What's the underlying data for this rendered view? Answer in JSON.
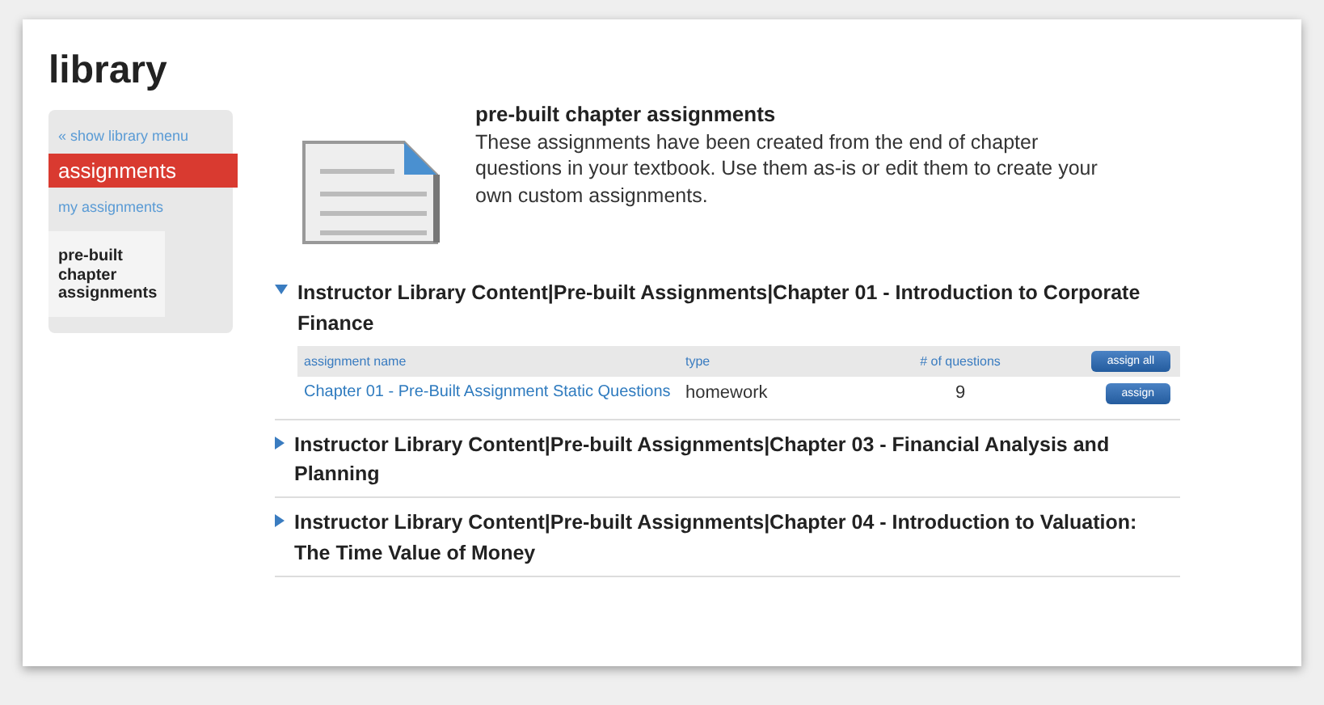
{
  "page_title": "library",
  "sidebar": {
    "items": [
      {
        "label": "« show library menu",
        "kind": "link",
        "selected": false
      },
      {
        "label": "assignments",
        "kind": "tab",
        "selected": true
      },
      {
        "label": "my assignments",
        "kind": "link",
        "selected": false
      },
      {
        "label": "pre-built chapter assignments",
        "kind": "current",
        "selected": false
      }
    ]
  },
  "intro": {
    "title": "pre-built chapter assignments",
    "text": "These assignments have been created from the end of chapter questions in your textbook. Use them as-is or edit them to create your own custom assignments."
  },
  "sections": [
    {
      "title": "Instructor Library Content|Pre-built Assignments|Chapter 01 - Introduction to Corporate Finance",
      "expanded": true,
      "table": {
        "columns": [
          "assignment name",
          "type",
          "# of questions"
        ],
        "header_button": "assign all",
        "rows": [
          {
            "name": "Chapter 01 - Pre-Built Assignment Static Questions",
            "type": "homework",
            "questions": "9",
            "button": "assign"
          }
        ]
      }
    },
    {
      "title": "Instructor Library Content|Pre-built Assignments|Chapter 03 - Financial Analysis and Planning",
      "expanded": false
    },
    {
      "title": "Instructor Library Content|Pre-built Assignments|Chapter 04 - Introduction to Valuation: The Time Value of Money",
      "expanded": false
    }
  ]
}
